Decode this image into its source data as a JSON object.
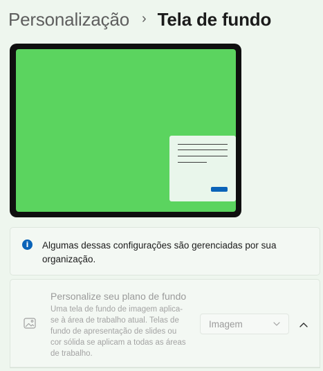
{
  "breadcrumb": {
    "parent": "Personalização",
    "separator": "›",
    "current": "Tela de fundo"
  },
  "info_bar": {
    "icon": "info-icon",
    "icon_glyph": "i",
    "message": "Algumas dessas configurações são gerenciadas por sua organização."
  },
  "background_setting": {
    "icon": "image-icon",
    "title": "Personalize seu plano de fundo",
    "description": "Uma tela de fundo de imagem aplica-se à área de trabalho atual. Telas de fundo de apresentação de slides ou cor sólida se aplicam a todas as áreas de trabalho.",
    "select_value": "Imagem",
    "disabled": true
  },
  "colors": {
    "page_background": "#eef6ee",
    "preview_wallpaper": "#5bd45f",
    "accent": "#0a63b8"
  }
}
